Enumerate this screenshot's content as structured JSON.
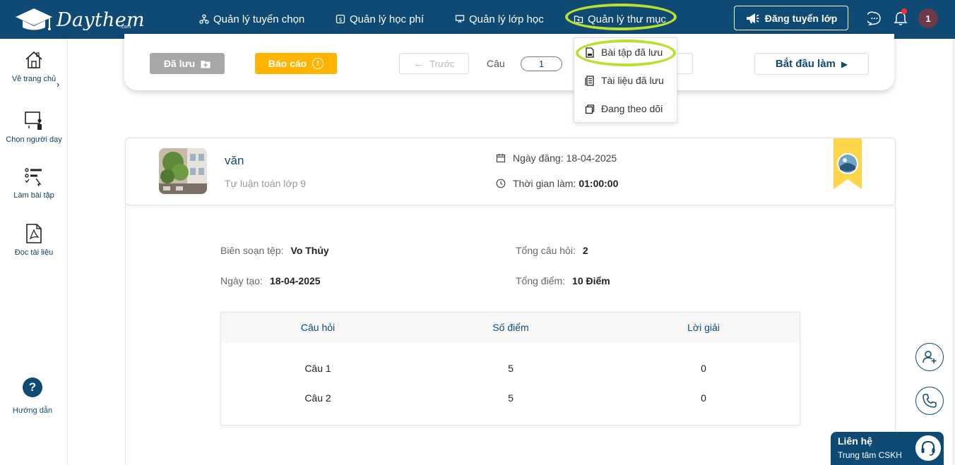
{
  "brand": {
    "name": "Daythem",
    "suffix": ".com"
  },
  "nav": {
    "items": [
      {
        "label": "Quản lý tuyển chọn",
        "icon": "people-network-icon"
      },
      {
        "label": "Quản lý học phí",
        "icon": "money-icon"
      },
      {
        "label": "Quản lý lớp học",
        "icon": "classroom-icon"
      },
      {
        "label": "Quản lý thư mục",
        "icon": "folder-icon"
      }
    ],
    "post_button": "Đăng tuyển lớp",
    "user_badge": "1"
  },
  "dropdown": {
    "items": [
      {
        "label": "Bài tập đã lưu",
        "icon": "saved-exercise-icon"
      },
      {
        "label": "Tài liệu đã lưu",
        "icon": "saved-document-icon"
      },
      {
        "label": "Đang theo dõi",
        "icon": "following-icon"
      }
    ]
  },
  "sidebar": {
    "items": [
      {
        "label": "Về trang chủ",
        "icon": "home-icon"
      },
      {
        "label": "Chọn người dạy",
        "icon": "teacher-board-icon"
      },
      {
        "label": "Làm bài tập",
        "icon": "exercise-list-icon"
      },
      {
        "label": "Đọc tài liệu",
        "icon": "pdf-document-icon"
      }
    ],
    "help": {
      "symbol": "?",
      "label": "Hướng dẫn"
    }
  },
  "toolbar": {
    "saved_label": "Đã lưu",
    "report_label": "Báo cáo",
    "report_symbol": "!",
    "prev_label": "Trước",
    "question_label": "Câu",
    "question_value": "1",
    "start_label": "Bắt đầu làm"
  },
  "exercise": {
    "title": "văn",
    "subtitle": "Tự luận toán lớp 9",
    "posted_label": "Ngày đăng:",
    "posted_date": "18-04-2025",
    "duration_label": "Thời gian làm:",
    "duration_value": "01:00:00"
  },
  "details": {
    "author_label": "Biên soạn tệp:",
    "author_value": "Vo Thủy",
    "created_label": "Ngày tạo:",
    "created_value": "18-04-2025",
    "total_q_label": "Tổng câu hỏi:",
    "total_q_value": "2",
    "total_score_label": "Tổng điểm:",
    "total_score_value": "10 Điểm"
  },
  "table": {
    "headers": [
      "Câu hỏi",
      "Số điểm",
      "Lời giải"
    ],
    "rows": [
      [
        "Câu 1",
        "5",
        "0"
      ],
      [
        "Câu 2",
        "5",
        "0"
      ]
    ]
  },
  "contact": {
    "title": "Liên hệ",
    "subtitle": "Trung tâm CSKH"
  },
  "colors": {
    "primary": "#0e4a74",
    "accent": "#ffb400",
    "highlight": "#b8e02c",
    "muted": "#a7a7a7"
  }
}
